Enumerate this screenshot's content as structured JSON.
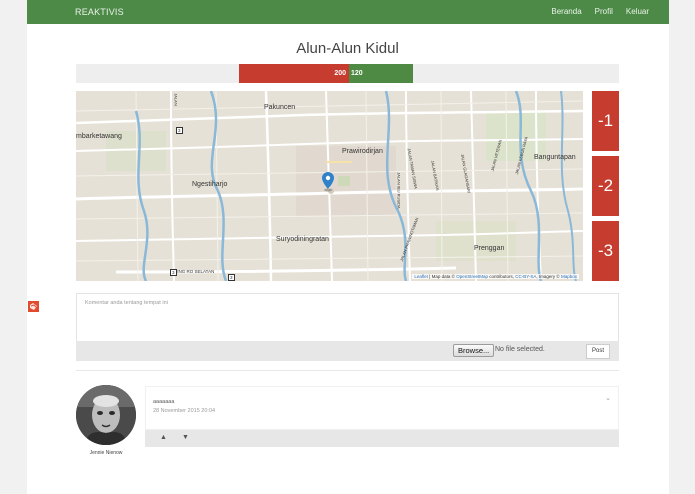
{
  "nav": {
    "brand": "REAKTIVIS",
    "links": [
      "Beranda",
      "Profil",
      "Keluar"
    ]
  },
  "place": {
    "title": "Alun-Alun Kidul"
  },
  "votes": {
    "negative": 200,
    "positive": 120
  },
  "map": {
    "labels": [
      "Pakuncen",
      "mbarketawang",
      "Prawirodirjan",
      "Banguntapan",
      "Ngestiharjo",
      "Suryodiningratan",
      "Prenggan",
      "RING RO SELATAN",
      "JALAN",
      "JALAN IBU RUSIDA",
      "JALAN TAMAN SISWA",
      "JALAN BATIKAN",
      "JALAN GLAGAHSARI",
      "JALAN VETERAN",
      "JALAN KEBUN RAYA",
      "JALAN PRAWIROTAMAN",
      "3",
      "3",
      "3"
    ],
    "attribution": {
      "leaflet": "Leaflet",
      "text1": "| Map data ©",
      "osm": "OpenStreetMap",
      "text2": "contributors,",
      "cc": "CC-BY-SA",
      "text3": ", Imagery ©",
      "mapbox": "Mapbox"
    }
  },
  "scores": [
    "-1",
    "-2",
    "-3"
  ],
  "comment_form": {
    "placeholder": "Komentar anda tentang tempat ini",
    "browse_label": "Browse...",
    "file_status": "No file selected.",
    "post_label": "Post"
  },
  "comments": [
    {
      "author": "Jennie Nienow",
      "text": "aaaaaaa",
      "date": "28 November 2015 20:04"
    }
  ],
  "colors": {
    "navbar": "#4d8a48",
    "negative": "#c63d30",
    "positive": "#4f8a45",
    "score": "#c63d30"
  }
}
